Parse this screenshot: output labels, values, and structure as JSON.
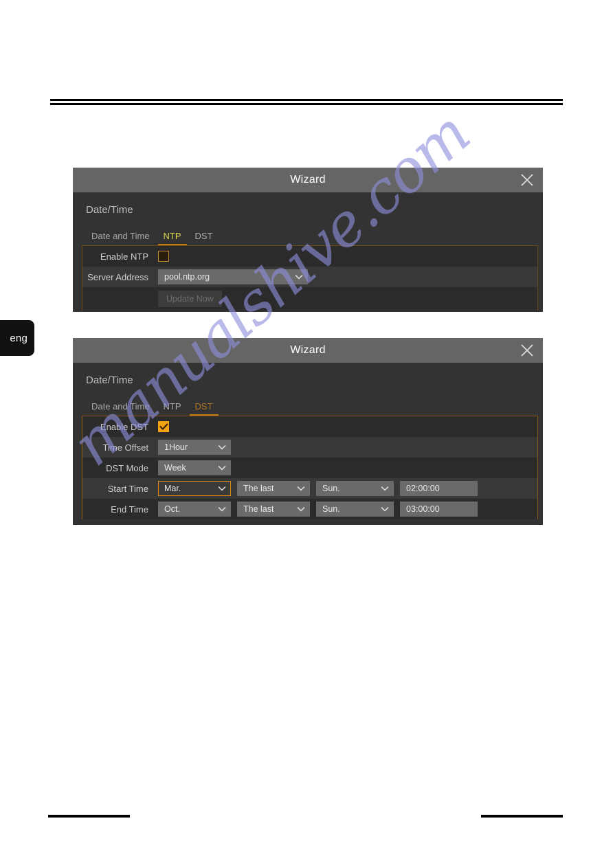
{
  "page": {
    "language_tab": "eng",
    "watermark": "manualshive.com"
  },
  "dialog_ntp": {
    "title": "Wizard",
    "close_icon": "close-icon",
    "section_title": "Date/Time",
    "tabs": [
      {
        "label": "Date and Time",
        "state": "inactive"
      },
      {
        "label": "NTP",
        "state": "active"
      },
      {
        "label": "DST",
        "state": "inactive"
      }
    ],
    "fields": {
      "enable_ntp_label": "Enable NTP",
      "enable_ntp_checked": "false",
      "server_address_label": "Server Address",
      "server_address_value": "pool.ntp.org",
      "update_now_label": "Update Now",
      "update_now_enabled": "false"
    }
  },
  "dialog_dst": {
    "title": "Wizard",
    "close_icon": "close-icon",
    "section_title": "Date/Time",
    "tabs": [
      {
        "label": "Date and Time",
        "state": "inactive"
      },
      {
        "label": "NTP",
        "state": "inactive"
      },
      {
        "label": "DST",
        "state": "active"
      }
    ],
    "fields": {
      "enable_dst_label": "Enable DST",
      "enable_dst_checked": "true",
      "time_offset_label": "Time Offset",
      "time_offset_value": "1Hour",
      "dst_mode_label": "DST Mode",
      "dst_mode_value": "Week",
      "start_time_label": "Start Time",
      "start_month": "Mar.",
      "start_week": "The last",
      "start_day": "Sun.",
      "start_clock": "02:00:00",
      "end_time_label": "End Time",
      "end_month": "Oct.",
      "end_week": "The last",
      "end_day": "Sun.",
      "end_clock": "03:00:00"
    }
  },
  "colors": {
    "accent_orange": "#f6a312",
    "tab_active_ntp": "#d8d64a",
    "tab_active_dst": "#b0741f",
    "titlebar": "#656565",
    "dialog_body": "#333333",
    "watermark": "#8f90dd"
  }
}
